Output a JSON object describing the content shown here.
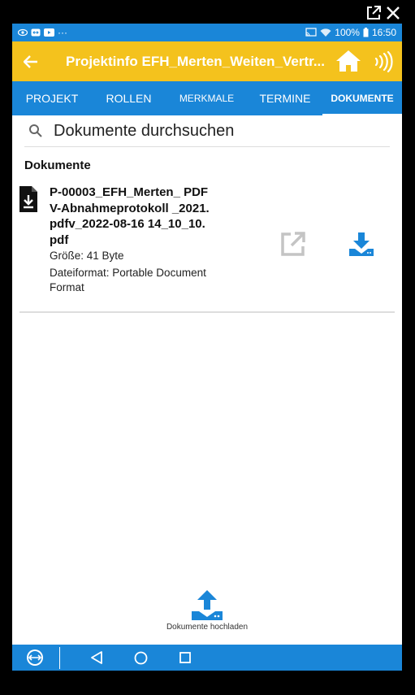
{
  "statusbar": {
    "battery": "100%",
    "time": "16:50"
  },
  "appbar": {
    "title": "Projektinfo EFH_Merten_Weiten_Vertr..."
  },
  "tabs": [
    {
      "label": "PROJEKT"
    },
    {
      "label": "ROLLEN"
    },
    {
      "label": "MERKMALE"
    },
    {
      "label": "TERMINE"
    },
    {
      "label": "DOKUMENTE"
    }
  ],
  "search": {
    "placeholder": "Dokumente durchsuchen"
  },
  "section": {
    "title": "Dokumente"
  },
  "document": {
    "name": "P-00003_EFH_Merten_ PDFV-Abnahmeprotokoll _2021.pdfv_2022-08-16 14_10_10.pdf",
    "size": "Größe: 41 Byte",
    "format": "Dateiformat: Portable Document Format"
  },
  "upload": {
    "label": "Dokumente hochladen"
  },
  "colors": {
    "accent_blue": "#1a86d8",
    "appbar_yellow": "#f4c21d"
  }
}
